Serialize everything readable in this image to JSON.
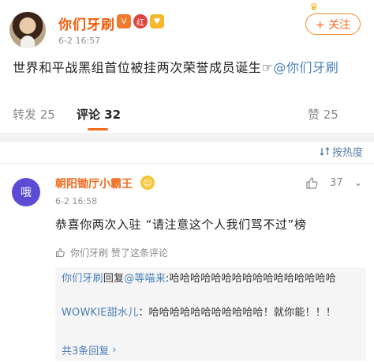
{
  "post": {
    "author": "你们牙刷",
    "time": "6-2 16:57",
    "follow_label": "+ 关注",
    "text": "世界和平战黑组首位被挂两次荣誉成员诞生☞",
    "mention": "@你们牙刷",
    "icons": {
      "avatar": "avatar",
      "vip": "vip-badge-icon",
      "red": "red-badge-icon",
      "fan": "fan-badge-icon",
      "crown": "crown-icon"
    }
  },
  "tabs": {
    "repost": "转发 25",
    "comment": "评论 32",
    "like": "赞 25",
    "sort": "按热度",
    "accent": "#f26b1d"
  },
  "comment": {
    "author": "朝阳锄厅小霸王",
    "avatar_text": "哦",
    "time": "6-2 16:58",
    "likes": "37",
    "text": "恭喜你两次入驻 “请注意这个人我们骂不过”榜",
    "liked_by": "你们牙刷  赞了这条评论",
    "replies": [
      {
        "name": "你们牙刷",
        "verb": "回复",
        "mention": "@等喵来",
        "text": ":哈哈哈哈哈哈哈哈哈哈哈哈哈哈哈哈"
      },
      {
        "name": "WOWKIE甜水儿",
        "verb": "",
        "mention": "",
        "text": "：哈哈哈哈哈哈哈哈哈哈哈！就你能！！！"
      }
    ],
    "more_replies": "共3条回复"
  }
}
